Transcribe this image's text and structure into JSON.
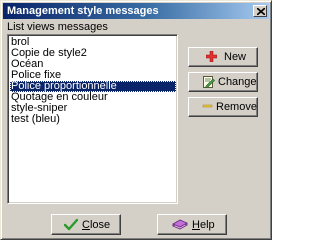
{
  "window": {
    "title": "Management style messages"
  },
  "list": {
    "label": "List views messages",
    "items": [
      "brol",
      "Copie de style2",
      "Océan",
      "Police fixe",
      "Police proportionnelle",
      "Quotage en couleur",
      "style-sniper",
      "test (bleu)"
    ],
    "selected_index": 4
  },
  "side_buttons": {
    "new_label": "New",
    "change_label": "Change",
    "remove_label": "Remove"
  },
  "bottom_buttons": {
    "close_label": "Close",
    "help_label": "Help"
  },
  "colors": {
    "selection": "#0a246a",
    "window_face": "#d4d0c8",
    "add_icon": "#e03030",
    "check_icon": "#2a9a2a"
  },
  "icons": {
    "new": "plus-icon",
    "change": "edit-document-icon",
    "remove": "minus-icon",
    "close": "checkmark-icon",
    "help": "help-book-icon",
    "titlebar_close": "close-icon"
  }
}
